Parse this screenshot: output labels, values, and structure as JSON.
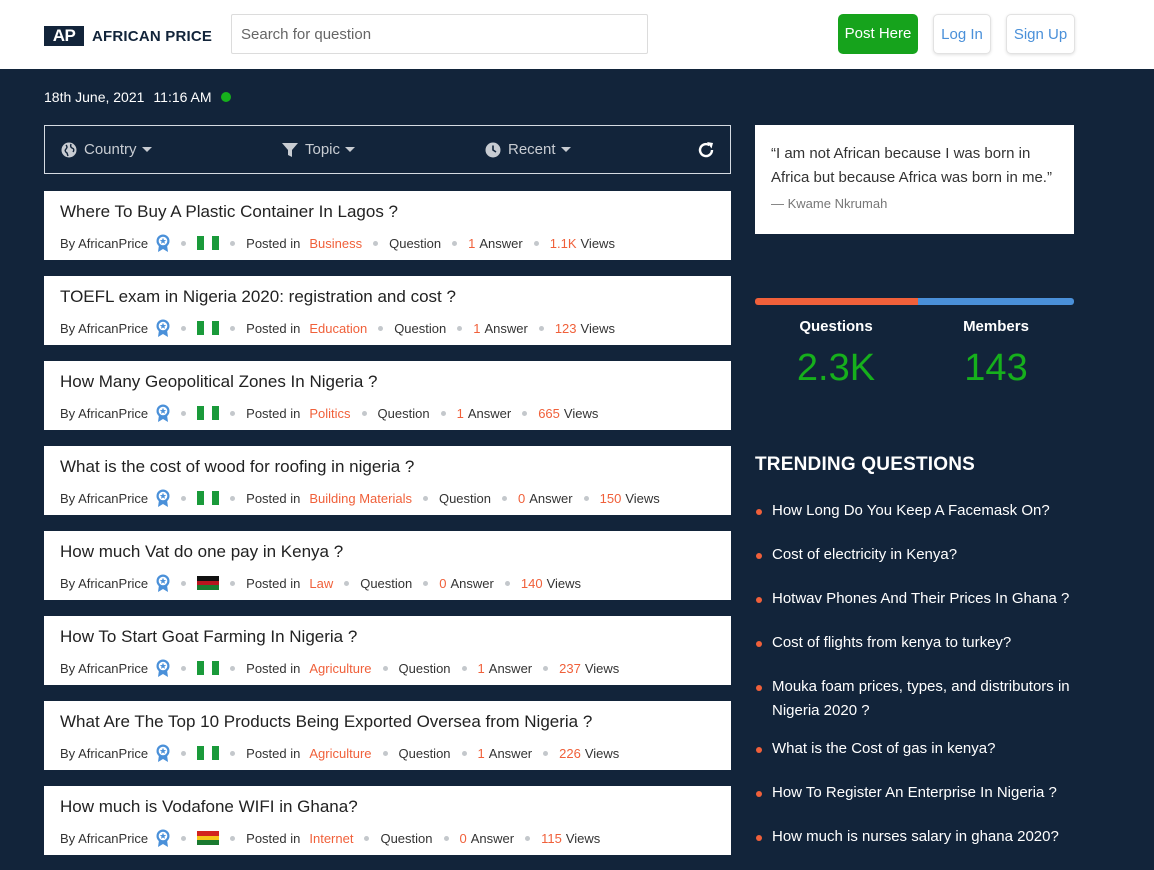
{
  "header": {
    "logo_mark": "AP",
    "logo_text": "AFRICAN PRICE",
    "search_placeholder": "Search for question",
    "post_label": "Post Here",
    "login_label": "Log In",
    "signup_label": "Sign Up"
  },
  "status": {
    "date": "18th June, 2021",
    "time": "11:16 AM"
  },
  "filters": {
    "country": "Country",
    "topic": "Topic",
    "recent": "Recent"
  },
  "questions": [
    {
      "title": "Where To Buy A Plastic Container In Lagos ?",
      "by": "By AfricanPrice",
      "posted_in": "Posted in",
      "category": "Business",
      "type": "Question",
      "answers": "1",
      "answers_label": "Answer",
      "views": "1.1K",
      "views_label": "Views",
      "flag": "nigeria"
    },
    {
      "title": "TOEFL exam in Nigeria 2020: registration and cost ?",
      "by": "By AfricanPrice",
      "posted_in": "Posted in",
      "category": "Education",
      "type": "Question",
      "answers": "1",
      "answers_label": "Answer",
      "views": "123",
      "views_label": "Views",
      "flag": "nigeria"
    },
    {
      "title": "How Many Geopolitical Zones In Nigeria ?",
      "by": "By AfricanPrice",
      "posted_in": "Posted in",
      "category": "Politics",
      "type": "Question",
      "answers": "1",
      "answers_label": "Answer",
      "views": "665",
      "views_label": "Views",
      "flag": "nigeria"
    },
    {
      "title": "What is the cost of wood for roofing in nigeria ?",
      "by": "By AfricanPrice",
      "posted_in": "Posted in",
      "category": "Building Materials",
      "type": "Question",
      "answers": "0",
      "answers_label": "Answer",
      "views": "150",
      "views_label": "Views",
      "flag": "nigeria"
    },
    {
      "title": "How much Vat do one pay in Kenya ?",
      "by": "By AfricanPrice",
      "posted_in": "Posted in",
      "category": "Law",
      "type": "Question",
      "answers": "0",
      "answers_label": "Answer",
      "views": "140",
      "views_label": "Views",
      "flag": "kenya"
    },
    {
      "title": "How To Start Goat Farming In Nigeria ?",
      "by": "By AfricanPrice",
      "posted_in": "Posted in",
      "category": "Agriculture",
      "type": "Question",
      "answers": "1",
      "answers_label": "Answer",
      "views": "237",
      "views_label": "Views",
      "flag": "nigeria"
    },
    {
      "title": "What Are The Top 10 Products Being Exported Oversea from Nigeria ?",
      "by": "By AfricanPrice",
      "posted_in": "Posted in",
      "category": "Agriculture",
      "type": "Question",
      "answers": "1",
      "answers_label": "Answer",
      "views": "226",
      "views_label": "Views",
      "flag": "nigeria"
    },
    {
      "title": "How much is Vodafone WIFI in Ghana?",
      "by": "By AfricanPrice",
      "posted_in": "Posted in",
      "category": "Internet",
      "type": "Question",
      "answers": "0",
      "answers_label": "Answer",
      "views": "115",
      "views_label": "Views",
      "flag": "ghana"
    }
  ],
  "sidebar": {
    "quote": "“I am not African because I was born in Africa but because Africa was born in me.”",
    "quote_author": "— Kwame Nkrumah",
    "stats": {
      "questions_label": "Questions",
      "questions_value": "2.3K",
      "members_label": "Members",
      "members_value": "143"
    },
    "trending_title": "TRENDING QUESTIONS",
    "trending": [
      "How Long Do You Keep A Facemask On?",
      "Cost of electricity in Kenya?",
      "Hotwav Phones And Their Prices In Ghana ?",
      "Cost of flights from kenya to turkey?",
      "Mouka foam prices, types, and distributors in Nigeria 2020 ?",
      "What is the Cost of gas in kenya?",
      "How To Register An Enterprise In Nigeria ?",
      "How much is nurses salary in ghana 2020?"
    ]
  },
  "colors": {
    "navy": "#12243a",
    "accent_orange": "#f0603a",
    "accent_blue": "#4a90d9",
    "green": "#16a31c"
  }
}
